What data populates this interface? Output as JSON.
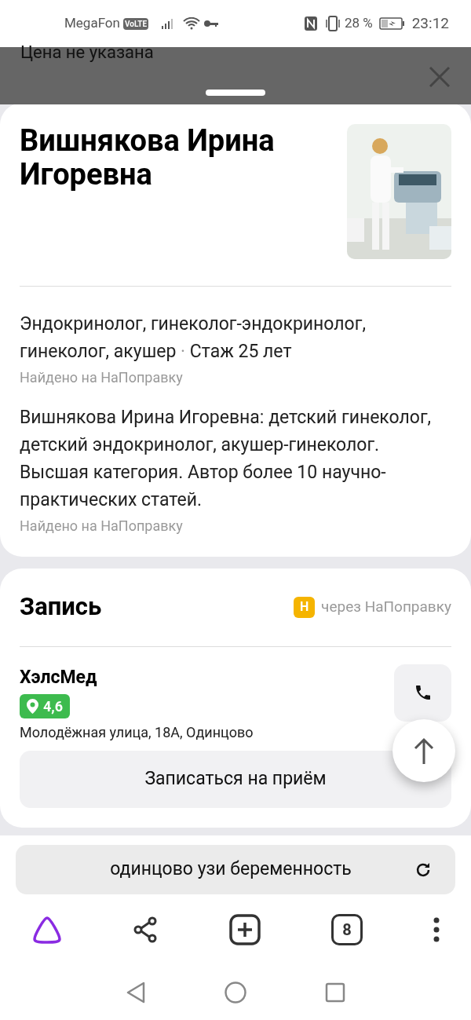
{
  "status_bar": {
    "carrier": "MegaFon",
    "volte": "VoLTE",
    "battery": "28 %",
    "time": "23:12"
  },
  "behind": {
    "price": "Цена не указана"
  },
  "doctor": {
    "name": "Вишнякова Ирина Игоревна",
    "specialties": "Эндокринолог, гинеколог-эндокринолог, гинеколог, акушер",
    "separator": "·",
    "experience": "Стаж 25 лет",
    "source_1": "Найдено на НаПоправку",
    "description": "Вишнякова Ирина Игоревна: детский гинеколог, детский эндокринолог, акушер-гинеколог. Высшая категория. Автор более 10 научно-практических статей.",
    "source_2": "Найдено на НаПоправку"
  },
  "booking": {
    "title": "Запись",
    "provider_badge": "Н",
    "provider": "через НаПоправку",
    "clinic": "ХэлсМед",
    "rating": "4,6",
    "address": "Молодёжная улица, 18А, Одинцово",
    "button": "Записаться на приём"
  },
  "browser": {
    "query": "одинцово узи беременность",
    "tabs_count": "8"
  }
}
